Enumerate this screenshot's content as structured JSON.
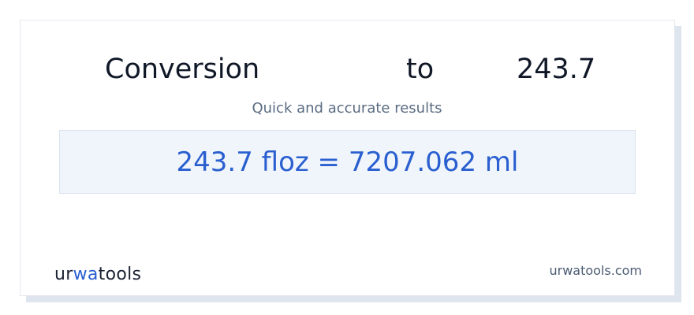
{
  "header": {
    "word_conversion": "Conversion",
    "word_to": "to",
    "word_value": "243.7"
  },
  "subtitle": "Quick and accurate results",
  "result": {
    "text": "243.7 floz = 7207.062 ml"
  },
  "branding": {
    "logo_prefix": "ur",
    "logo_accent": "wa",
    "logo_suffix": "tools",
    "logo_icon": "glasses-icon",
    "site_url": "urwatools.com"
  },
  "colors": {
    "accent": "#2a5fd0",
    "title_text": "#101828",
    "subtitle_text": "#5a6b82",
    "result_background": "#f0f5fb"
  }
}
